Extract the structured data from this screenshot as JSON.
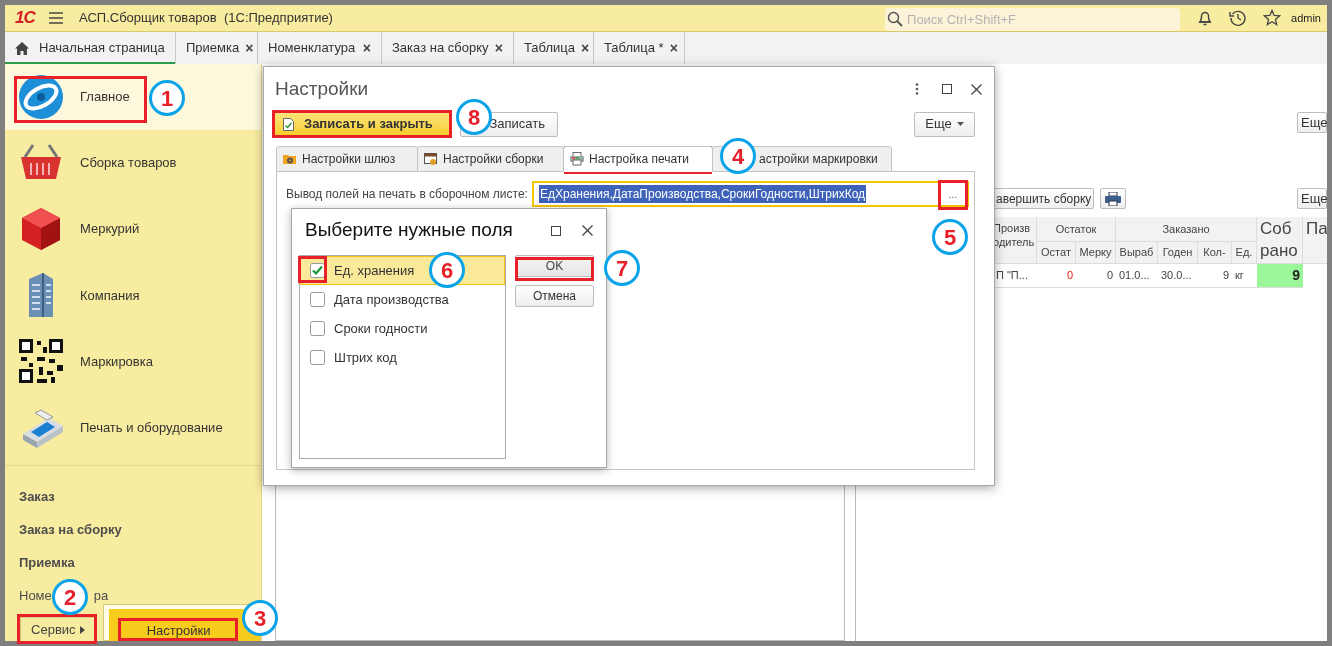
{
  "app_bar": {
    "logo": "1С",
    "title": "АСП.Сборщик товаров  (1С:Предприятие)",
    "search": {
      "placeholder": "Поиск Ctrl+Shift+F"
    },
    "user": "admin"
  },
  "tabs": [
    {
      "label": "Начальная страница",
      "selected": true
    },
    {
      "label": "Приемка",
      "selected": false,
      "close": "×"
    },
    {
      "label": "Номенклатура",
      "selected": false,
      "close": "×"
    },
    {
      "label": "Заказ на сборку",
      "selected": false,
      "close": "×"
    },
    {
      "label": "Таблица",
      "selected": false,
      "close": "×"
    },
    {
      "label": "Таблица *",
      "selected": false,
      "close": "×"
    }
  ],
  "sidebar": {
    "sections": [
      {
        "label": "Главное",
        "selected": true,
        "kind": "main"
      },
      {
        "label": "Сборка товаров",
        "selected": false,
        "kind": "basket"
      },
      {
        "label": "Меркурий",
        "selected": false,
        "kind": "cube"
      },
      {
        "label": "Компания",
        "selected": false,
        "kind": "building"
      },
      {
        "label": "Маркировка",
        "selected": false,
        "kind": "qr"
      },
      {
        "label": "Печать и оборудование",
        "selected": false,
        "kind": "terminal"
      }
    ],
    "links": [
      {
        "label": "Заказ",
        "bold": true
      },
      {
        "label": "Заказ на сборку",
        "bold": true
      },
      {
        "label": "Приемка",
        "bold": true
      },
      {
        "label": "Номе",
        "label_end": "ра",
        "bold": false
      }
    ],
    "service_button": "Сервис",
    "service_menu": [
      {
        "label": "Настройки",
        "selected": true
      }
    ]
  },
  "background_document": {
    "more_buttons": [
      "Еще",
      "Еще"
    ],
    "finish_button": "авершить сборку",
    "table": {
      "header": [
        "Произв одитель",
        "Остаток",
        "Заказано",
        "Соб рано",
        "Па"
      ],
      "subheader": [
        "Остат",
        "Мерку",
        "Выраб",
        "Годен",
        "Кол-",
        "Ед."
      ],
      "rows": [
        [
          {
            "text": "П \"П...",
            "kind": "plain"
          },
          {
            "text": "0",
            "kind": "alert"
          },
          {
            "text": "0",
            "kind": "plain"
          },
          {
            "text": "01.0...",
            "kind": "plain"
          },
          {
            "text": "30.0...",
            "kind": "plain"
          },
          {
            "text": "9",
            "kind": "plain"
          },
          {
            "text": "кг",
            "kind": "plain"
          },
          {
            "text": "9",
            "kind": "done"
          }
        ]
      ]
    }
  },
  "settings_dialog": {
    "title": "Настройки",
    "toolbar": [
      {
        "label": "Записать и закрыть",
        "kind": "primary"
      },
      {
        "label": "Записать",
        "kind": "plain"
      },
      {
        "label": "Еще",
        "kind": "menu"
      }
    ],
    "tabs": [
      {
        "label": "Настройки шлюз",
        "selected": false,
        "kind": "gear"
      },
      {
        "label": "Настройки сборки",
        "selected": false,
        "kind": "box"
      },
      {
        "label": "Настройка печати",
        "selected": true,
        "kind": "printer"
      },
      {
        "label": "астройки маркировки",
        "selected": false,
        "kind": "none"
      }
    ],
    "field": {
      "label": "Вывод полей на печать в сборочном листе:",
      "value": "ЕдХранения,ДатаПроизводства,СрокиГодности,ШтрихКод",
      "choose": "..."
    }
  },
  "fields_dialog": {
    "title": "Выберите нужные поля",
    "items": [
      {
        "label": "Ед. хранения",
        "checked": true,
        "selected": true
      },
      {
        "label": "Дата производства",
        "checked": false,
        "selected": false
      },
      {
        "label": "Сроки годности",
        "checked": false,
        "selected": false
      },
      {
        "label": "Штрих код",
        "checked": false,
        "selected": false
      }
    ],
    "buttons": [
      {
        "label": "OK",
        "kind": "default"
      },
      {
        "label": "Отмена",
        "kind": "plain"
      }
    ]
  },
  "callouts": [
    "1",
    "2",
    "3",
    "4",
    "5",
    "6",
    "7",
    "8"
  ]
}
